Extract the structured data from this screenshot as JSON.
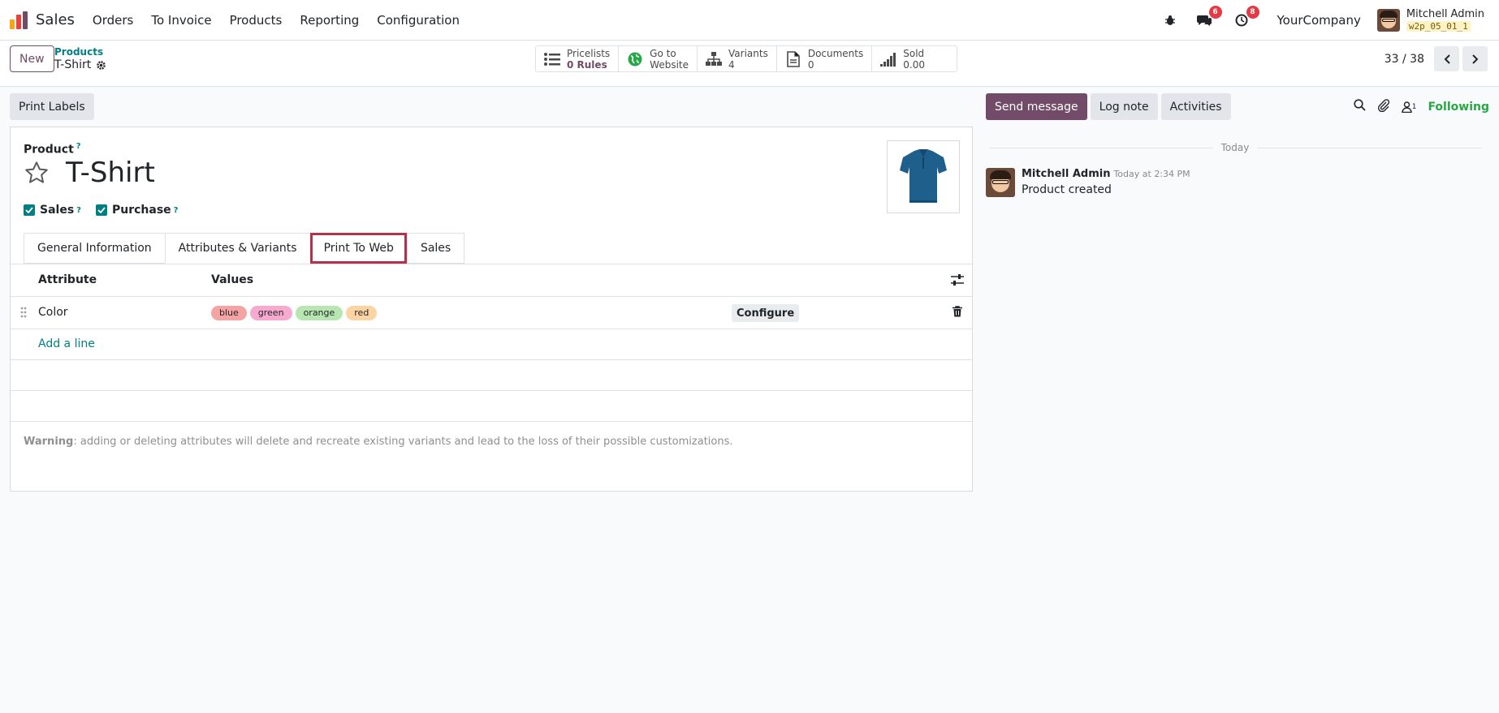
{
  "navbar": {
    "app_name": "Sales",
    "menu": [
      "Orders",
      "To Invoice",
      "Products",
      "Reporting",
      "Configuration"
    ],
    "messages_badge": "6",
    "activities_badge": "8",
    "company": "YourCompany",
    "user_name": "Mitchell Admin",
    "database": "w2p_05_01_1"
  },
  "control": {
    "new_label": "New",
    "breadcrumb_parent": "Products",
    "breadcrumb_current": "T-Shirt",
    "smart_buttons": [
      {
        "label": "Pricelists",
        "value": "0 Rules"
      },
      {
        "label": "Go to",
        "value": "Website"
      },
      {
        "label": "Variants",
        "value": "4"
      },
      {
        "label": "Documents",
        "value": "0"
      },
      {
        "label": "Sold",
        "value": "0.00"
      }
    ],
    "pager": "33 / 38"
  },
  "form": {
    "print_labels": "Print Labels",
    "product_label": "Product",
    "help_mark": "?",
    "name": "T-Shirt",
    "sales_label": "Sales",
    "purchase_label": "Purchase",
    "tabs": [
      "General Information",
      "Attributes & Variants",
      "Print To Web",
      "Sales"
    ],
    "table": {
      "col_attribute": "Attribute",
      "col_values": "Values",
      "rows": [
        {
          "attribute": "Color",
          "values": [
            "blue",
            "green",
            "orange",
            "red"
          ],
          "action": "Configure"
        }
      ],
      "add_line": "Add a line"
    },
    "warning_bold": "Warning",
    "warning_text": ": adding or deleting attributes will delete and recreate existing variants and lead to the loss of their possible customizations.",
    "tag_colors": {
      "blue": "#f5a3a3",
      "green": "#f7a9d0",
      "orange": "#b8e6b0",
      "red": "#fcd3a3"
    }
  },
  "chatter": {
    "send_message": "Send message",
    "log_note": "Log note",
    "activities": "Activities",
    "followers_count": "1",
    "following": "Following",
    "date_separator": "Today",
    "message": {
      "author": "Mitchell Admin",
      "time": "Today at 2:34 PM",
      "text": "Product created"
    }
  },
  "colors": {
    "brand": "#714b67",
    "link": "#017e84",
    "highlight": "#b3314a",
    "following": "#28a745"
  }
}
